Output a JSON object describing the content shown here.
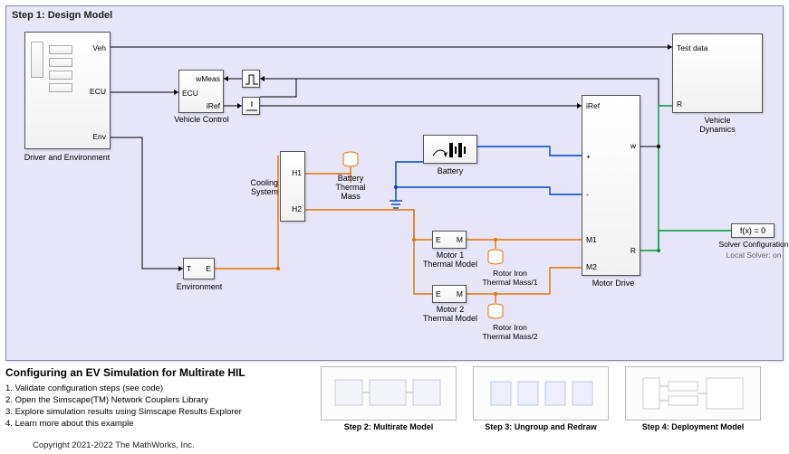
{
  "panel": {
    "title": "Step 1: Design Model"
  },
  "blocks": {
    "driver_env": {
      "label": "Driver and Environment",
      "ports": {
        "veh": "Veh",
        "ecu": "ECU",
        "env": "Env"
      }
    },
    "vehicle_control": {
      "label": "Vehicle Control",
      "ports": {
        "wmeas": "wMeas",
        "ecu": "ECU",
        "iref": "iRef"
      }
    },
    "pulse": {
      "label": ""
    },
    "sum": {
      "label": ""
    },
    "environment": {
      "label": "Environment",
      "ports": {
        "t": "T",
        "e": "E"
      }
    },
    "cooling": {
      "label": "Cooling\nSystem",
      "ports": {
        "h1": "H1",
        "h2": "H2"
      }
    },
    "battery": {
      "label": "Battery"
    },
    "btm": {
      "label": "Battery\nThermal\nMass"
    },
    "motor1_tm": {
      "label": "Motor 1\nThermal Model",
      "ports": {
        "e": "E",
        "m": "M"
      }
    },
    "motor2_tm": {
      "label": "Motor 2\nThermal Model",
      "ports": {
        "e": "E",
        "m": "M"
      }
    },
    "rotor1": {
      "label": "Rotor Iron\nThermal Mass/1"
    },
    "rotor2": {
      "label": "Rotor Iron\nThermal Mass/2"
    },
    "motor_drive": {
      "label": "Motor Drive",
      "ports": {
        "iref": "iRef",
        "plus": "+",
        "minus": "-",
        "m1": "M1",
        "m2": "M2",
        "w": "w",
        "r": "R"
      }
    },
    "vehicle_dynamics": {
      "label": "Vehicle\nDynamics",
      "ports": {
        "test": "Test data",
        "r": "R"
      }
    },
    "solver": {
      "label": "Solver Configuration",
      "sub": "Local Solver: on",
      "expr": "f(x) = 0"
    }
  },
  "footer": {
    "title": "Configuring an EV Simulation for Multirate HIL",
    "items": [
      "Validate configuration steps (see code)",
      "Open the Simscape(TM) Network Couplers Library",
      "Explore simulation results using Simscape Results Explorer",
      "Learn more about this example"
    ],
    "steps": [
      "Step 2: Multirate Model",
      "Step 3: Ungroup and Redraw",
      "Step 4: Deployment Model"
    ],
    "copyright": "Copyright 2021-2022 The MathWorks, Inc."
  },
  "colors": {
    "signal": "#000000",
    "thermal": "#e57300",
    "elec": "#0044cc",
    "mech": "#009933"
  }
}
